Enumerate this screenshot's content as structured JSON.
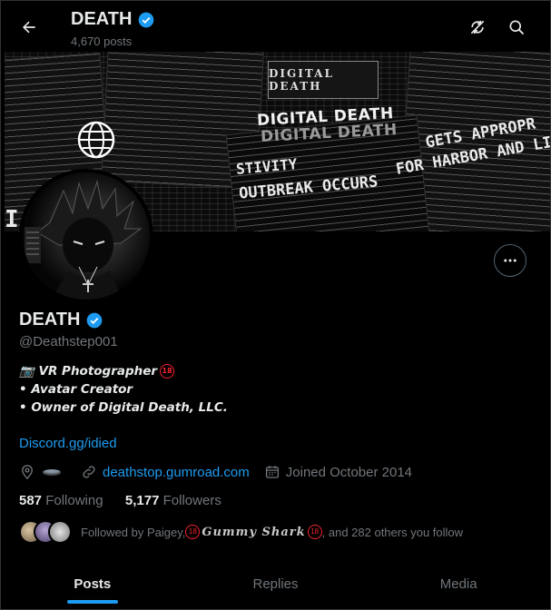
{
  "header": {
    "title": "DEATH",
    "posts": "4,670 posts"
  },
  "banner": {
    "headline_1": "DIGITAL DEATH",
    "headline_2": "DIGITAL DEATH",
    "line_left": "STIVITY",
    "line_outbreak": "OUTBREAK OCCURS",
    "line_right_1": "GETS APPROPR",
    "line_right_2": "FOR HARBOR AND LI",
    "logo_text": "DIGITAL DEATH"
  },
  "profile": {
    "name": "DEATH",
    "handle": "@Deathstep001",
    "bio": [
      "📷 VR Photographer",
      "• Avatar Creator",
      "• Owner of Digital Death, LLC."
    ],
    "badge_18": "18",
    "bio_link": "Discord.gg/idied",
    "website": "deathstop.gumroad.com",
    "joined": "Joined October 2014"
  },
  "stats": {
    "following_count": "587",
    "following_label": "Following",
    "followers_count": "5,177",
    "followers_label": "Followers"
  },
  "followed_by": {
    "prefix": "Followed by Paigey, ",
    "fancy_name": "Gummy Shark",
    "suffix": ", and 282 others you follow"
  },
  "tabs": [
    {
      "label": "Posts",
      "active": true
    },
    {
      "label": "Replies",
      "active": false
    },
    {
      "label": "Media",
      "active": false
    }
  ],
  "colors": {
    "accent": "#1d9bf0",
    "verified": "#1d9bf0",
    "muted": "#71767b",
    "adult_badge": "#f4212e"
  },
  "icons": [
    "arrow-left-icon",
    "verified-badge-icon",
    "refresh-off-icon",
    "search-icon",
    "more-icon",
    "location-icon",
    "link-icon",
    "calendar-icon"
  ]
}
